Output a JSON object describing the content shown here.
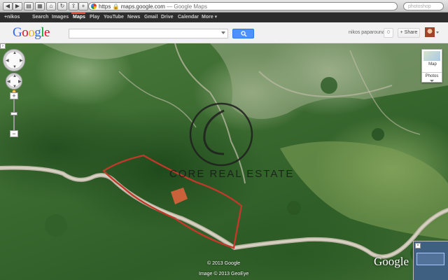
{
  "browser": {
    "url": "https://maps.google.com/",
    "url_prefix": "https",
    "url_host": "maps.google.com",
    "page_title": "— Google Maps",
    "search_placeholder": "photoshop"
  },
  "gbar": {
    "items": [
      "+nikos",
      "Search",
      "Images",
      "Maps",
      "Play",
      "YouTube",
      "News",
      "Gmail",
      "Drive",
      "Calendar",
      "More ▾"
    ],
    "active": "Maps"
  },
  "header": {
    "logo": "Google",
    "search_value": "",
    "user_name": "nikos paparounas",
    "notifications": "0",
    "share_label": "+ Share"
  },
  "map": {
    "type_primary": "Map",
    "type_secondary": "Photos",
    "watermark": "CORE REAL ESTATE",
    "copyright_google": "© 2013 Google",
    "copyright_image": "Image © 2013 GeoEye",
    "corner_logo": "Google",
    "boundary_color": "#c0392b"
  }
}
